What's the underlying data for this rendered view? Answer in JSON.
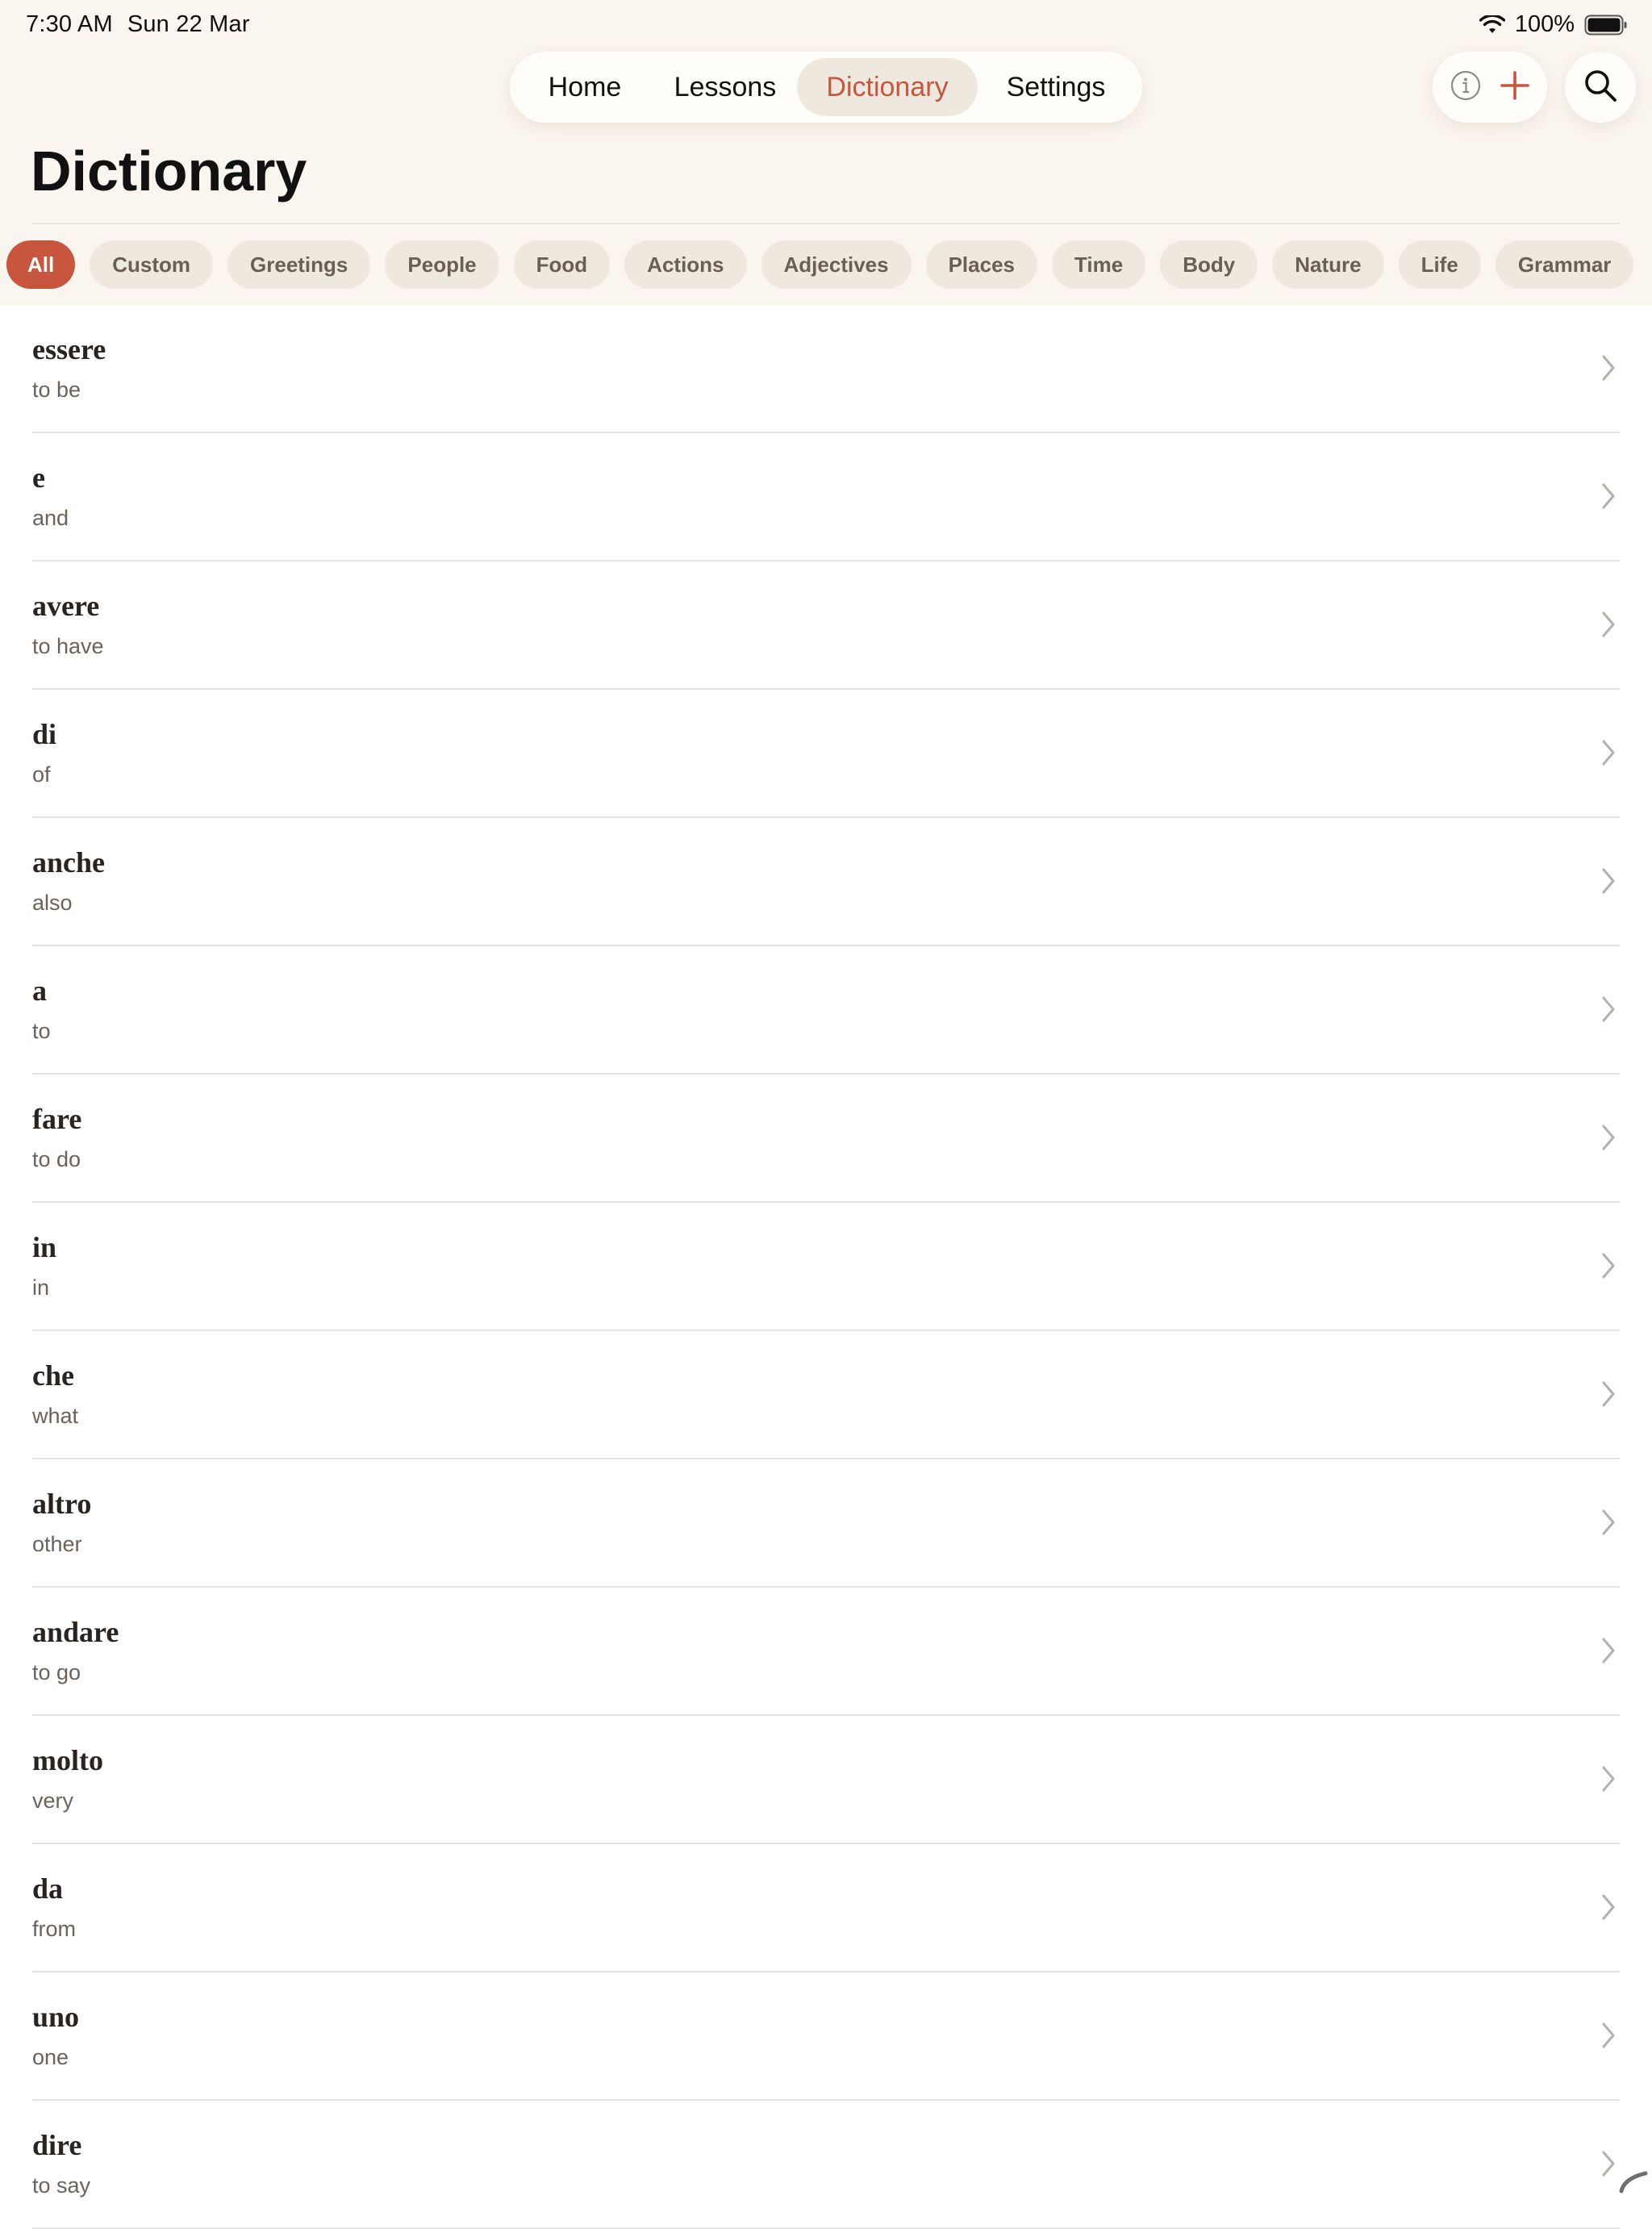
{
  "status_bar": {
    "time": "7:30 AM",
    "date": "Sun 22 Mar",
    "battery": "100%"
  },
  "nav": {
    "tabs": [
      {
        "label": "Home"
      },
      {
        "label": "Lessons"
      },
      {
        "label": "Dictionary"
      },
      {
        "label": "Settings"
      }
    ],
    "active_tab": "Dictionary"
  },
  "actions": {
    "icons": [
      "info-icon",
      "plus-icon",
      "search-icon"
    ]
  },
  "page": {
    "title": "Dictionary"
  },
  "categories": {
    "items": [
      "All",
      "Custom",
      "Greetings",
      "People",
      "Food",
      "Actions",
      "Adjectives",
      "Places",
      "Time",
      "Body",
      "Nature",
      "Life",
      "Grammar"
    ],
    "selected": "All"
  },
  "words": [
    {
      "term": "essere",
      "meaning": "to be"
    },
    {
      "term": "e",
      "meaning": "and"
    },
    {
      "term": "avere",
      "meaning": "to have"
    },
    {
      "term": "di",
      "meaning": "of"
    },
    {
      "term": "anche",
      "meaning": "also"
    },
    {
      "term": "a",
      "meaning": "to"
    },
    {
      "term": "fare",
      "meaning": "to do"
    },
    {
      "term": "in",
      "meaning": "in"
    },
    {
      "term": "che",
      "meaning": "what"
    },
    {
      "term": "altro",
      "meaning": "other"
    },
    {
      "term": "andare",
      "meaning": "to go"
    },
    {
      "term": "molto",
      "meaning": "very"
    },
    {
      "term": "da",
      "meaning": "from"
    },
    {
      "term": "uno",
      "meaning": "one"
    },
    {
      "term": "dire",
      "meaning": "to say"
    }
  ],
  "colors": {
    "accent": "#c8553d",
    "header_bg": "#faf5ee",
    "chip_bg": "#efe8de"
  }
}
